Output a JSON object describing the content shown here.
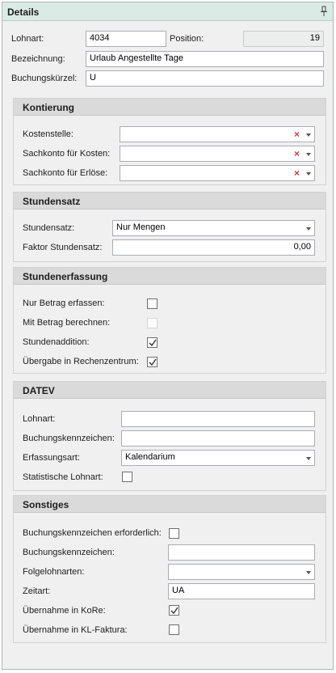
{
  "panel": {
    "title": "Details"
  },
  "main": {
    "lohnart_label": "Lohnart:",
    "lohnart_value": "4034",
    "position_label": "Position:",
    "position_value": "19",
    "bezeichnung_label": "Bezeichnung:",
    "bezeichnung_value": "Urlaub Angestellte Tage",
    "buchungskuerzel_label": "Buchungskürzel:",
    "buchungskuerzel_value": "U"
  },
  "kontierung": {
    "title": "Kontierung",
    "kostenstelle_label": "Kostenstelle:",
    "sachkonto_kosten_label": "Sachkonto für Kosten:",
    "sachkonto_erloese_label": "Sachkonto für Erlöse:"
  },
  "stundensatz": {
    "title": "Stundensatz",
    "stundensatz_label": "Stundensatz:",
    "stundensatz_value": "Nur Mengen",
    "faktor_label": "Faktor Stundensatz:",
    "faktor_value": "0,00"
  },
  "stundenerfassung": {
    "title": "Stundenerfassung",
    "nur_betrag_label": "Nur Betrag erfassen:",
    "nur_betrag_checked": false,
    "mit_betrag_label": "Mit Betrag berechnen:",
    "mit_betrag_checked": false,
    "stundenaddition_label": "Stundenaddition:",
    "stundenaddition_checked": true,
    "uebergabe_label": "Übergabe in Rechenzentrum:",
    "uebergabe_checked": true
  },
  "datev": {
    "title": "DATEV",
    "lohnart_label": "Lohnart:",
    "lohnart_value": "",
    "buchungskennzeichen_label": "Buchungskennzeichen:",
    "buchungskennzeichen_value": "",
    "erfassungsart_label": "Erfassungsart:",
    "erfassungsart_value": "Kalendarium",
    "statistische_label": "Statistische Lohnart:",
    "statistische_checked": false
  },
  "sonstiges": {
    "title": "Sonstiges",
    "bkz_erforderlich_label": "Buchungskennzeichen erforderlich:",
    "bkz_erforderlich_checked": false,
    "buchungskennzeichen_label": "Buchungskennzeichen:",
    "buchungskennzeichen_value": "",
    "folgelohnarten_label": "Folgelohnarten:",
    "folgelohnarten_value": "",
    "zeitart_label": "Zeitart:",
    "zeitart_value": "UA",
    "uebernahme_kore_label": "Übernahme in KoRe:",
    "uebernahme_kore_checked": true,
    "uebernahme_kl_label": "Übernahme in KL-Faktura:",
    "uebernahme_kl_checked": false
  },
  "colors": {
    "header_bg": "#d9ebe4",
    "group_header_bg": "#dadada",
    "clear_x": "#d43a3a"
  },
  "icons": {
    "pin": "pin-icon",
    "clear": "clear-x-icon",
    "dropdown": "chevron-down-icon",
    "check": "checkmark-icon"
  }
}
